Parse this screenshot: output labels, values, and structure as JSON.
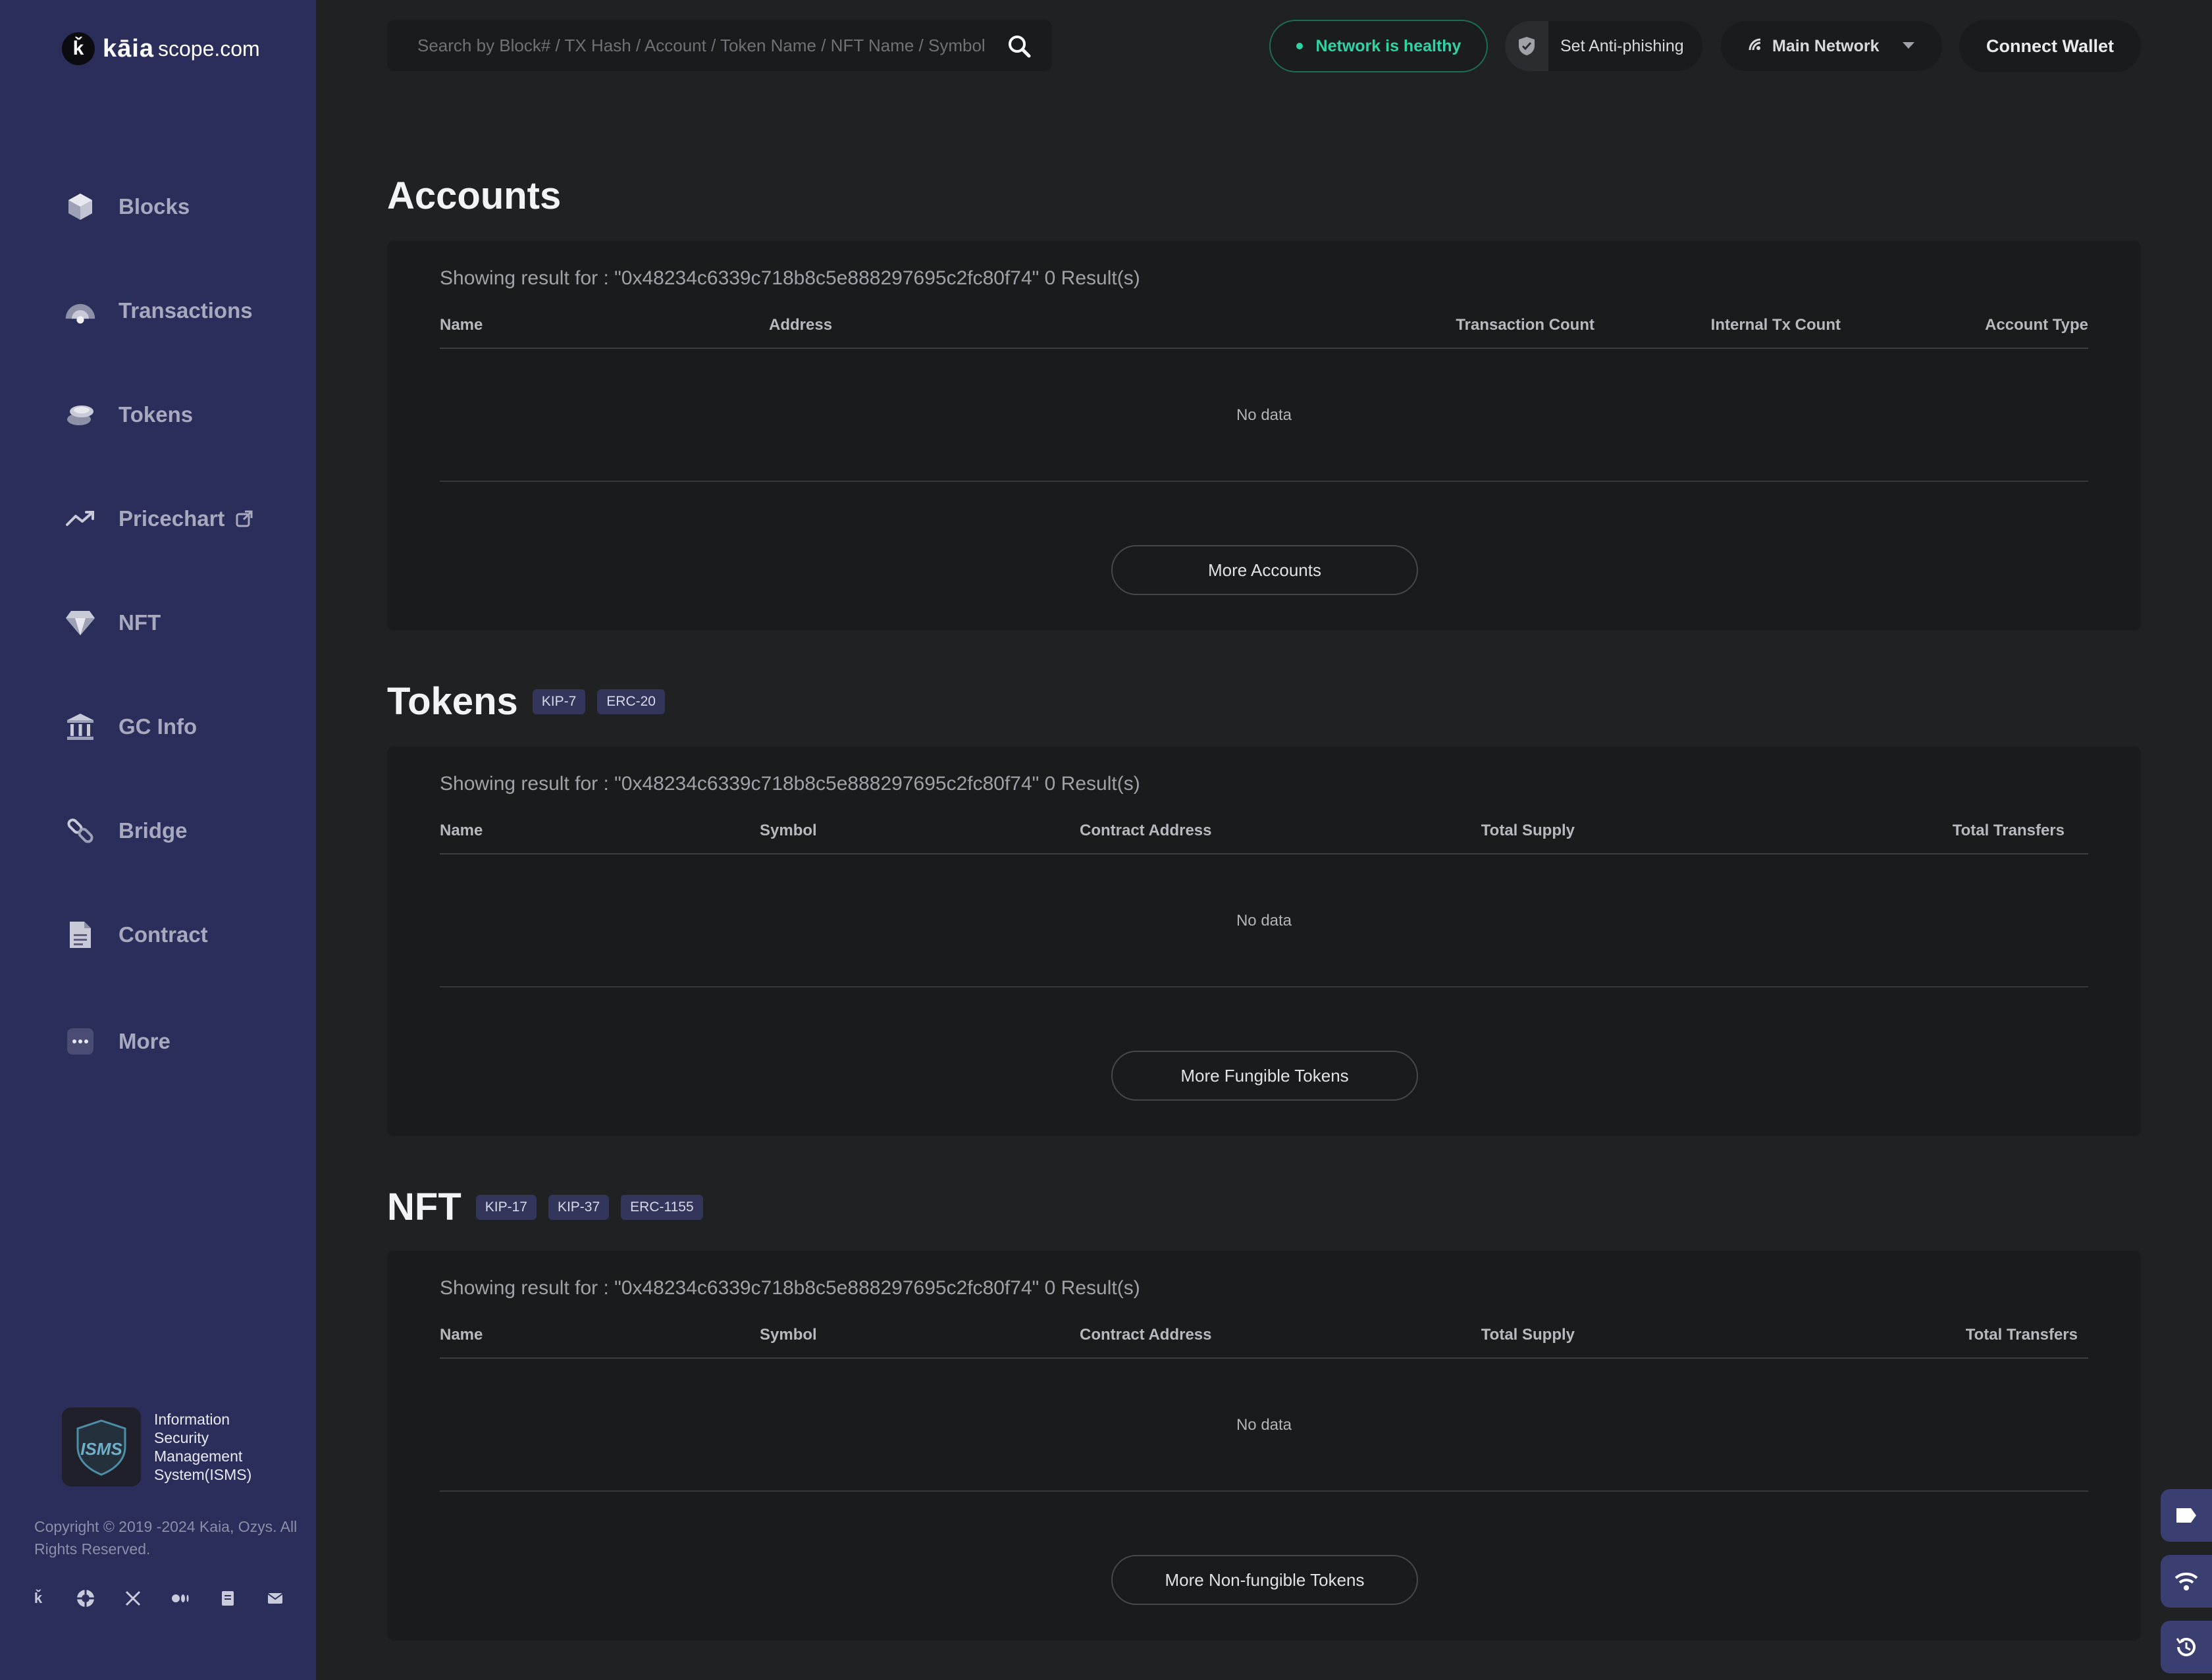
{
  "brand": {
    "mark": "ǩ",
    "name": "kāia",
    "domain": "scope.com"
  },
  "sidebar": {
    "items": [
      {
        "label": "Blocks",
        "icon": "cube-icon"
      },
      {
        "label": "Transactions",
        "icon": "transactions-icon"
      },
      {
        "label": "Tokens",
        "icon": "coins-icon"
      },
      {
        "label": "Pricechart",
        "icon": "trend-up-icon",
        "external": true
      },
      {
        "label": "NFT",
        "icon": "diamond-icon"
      },
      {
        "label": "GC Info",
        "icon": "bank-icon"
      },
      {
        "label": "Bridge",
        "icon": "bridge-icon"
      },
      {
        "label": "Contract",
        "icon": "document-icon"
      },
      {
        "label": "More",
        "icon": "more-icon"
      }
    ],
    "isms": {
      "badge_text": "ISMS",
      "label": "Information Security Management System(ISMS)"
    },
    "copyright": "Copyright © 2019 -2024 Kaia, Ozys. All Rights Reserved.",
    "socials": [
      "kaia-icon",
      "discourse-icon",
      "x-icon",
      "medium-icon",
      "docs-icon",
      "mail-icon"
    ]
  },
  "header": {
    "search_placeholder": "Search by Block# / TX Hash / Account / Token Name / NFT Name / Symbol",
    "network_status": "Network is healthy",
    "anti_phishing": "Set Anti-phishing",
    "network": "Main Network",
    "connect_wallet": "Connect Wallet"
  },
  "colors": {
    "sidebar_bg": "#2b2d5a",
    "page_bg": "#1f2123",
    "card_bg": "#1a1b1d",
    "healthy": "#2fd3a4",
    "tag_bg": "#33355a"
  },
  "sections": {
    "accounts": {
      "title": "Accounts",
      "result": "Showing result for : \"0x48234c6339c718b8c5e888297695c2fc80f74\" 0 Result(s)",
      "columns": [
        "Name",
        "Address",
        "Transaction Count",
        "Internal Tx Count",
        "Account Type"
      ],
      "empty": "No data",
      "more": "More Accounts"
    },
    "tokens": {
      "title": "Tokens",
      "tags": [
        "KIP-7",
        "ERC-20"
      ],
      "result": "Showing result for : \"0x48234c6339c718b8c5e888297695c2fc80f74\" 0 Result(s)",
      "columns": [
        "Name",
        "Symbol",
        "Contract Address",
        "Total Supply",
        "Total Transfers"
      ],
      "empty": "No data",
      "more": "More Fungible Tokens"
    },
    "nft": {
      "title": "NFT",
      "tags": [
        "KIP-17",
        "KIP-37",
        "ERC-1155"
      ],
      "result": "Showing result for : \"0x48234c6339c718b8c5e888297695c2fc80f74\" 0 Result(s)",
      "columns": [
        "Name",
        "Symbol",
        "Contract Address",
        "Total Supply",
        "Total Transfers"
      ],
      "empty": "No data",
      "more": "More Non-fungible Tokens"
    }
  },
  "floating_tools": [
    "tag-icon",
    "wifi-icon",
    "history-icon"
  ]
}
